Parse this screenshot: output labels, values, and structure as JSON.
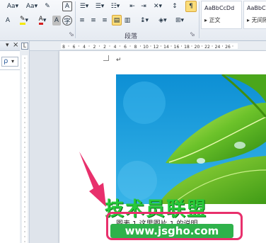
{
  "ribbon": {
    "font_size_label": "Aa",
    "clear_format_label": "A",
    "font_color_label": "A",
    "char_label": "A",
    "paragraph_group": "段落",
    "styles": [
      {
        "sample": "AaBbCcDd",
        "name": "正文"
      },
      {
        "sample": "AaBbCcDd",
        "name": "无间隔"
      }
    ]
  },
  "nav_pane": {
    "search_glyph": "ρ"
  },
  "ruler": {
    "marks": [
      "8",
      "6",
      "4",
      "2",
      "2",
      "4",
      "6",
      "8",
      "10",
      "12",
      "14",
      "16",
      "18",
      "20",
      "22",
      "24",
      "26"
    ]
  },
  "document": {
    "caption": "图表 1 这里图片 1 的说明",
    "paragraph_mark": "↵"
  },
  "watermark": {
    "main": "技术员联盟",
    "url": "www.jsgho.com"
  },
  "colors": {
    "highlight": "#e8306c",
    "watermark_green": "#27c93a"
  }
}
